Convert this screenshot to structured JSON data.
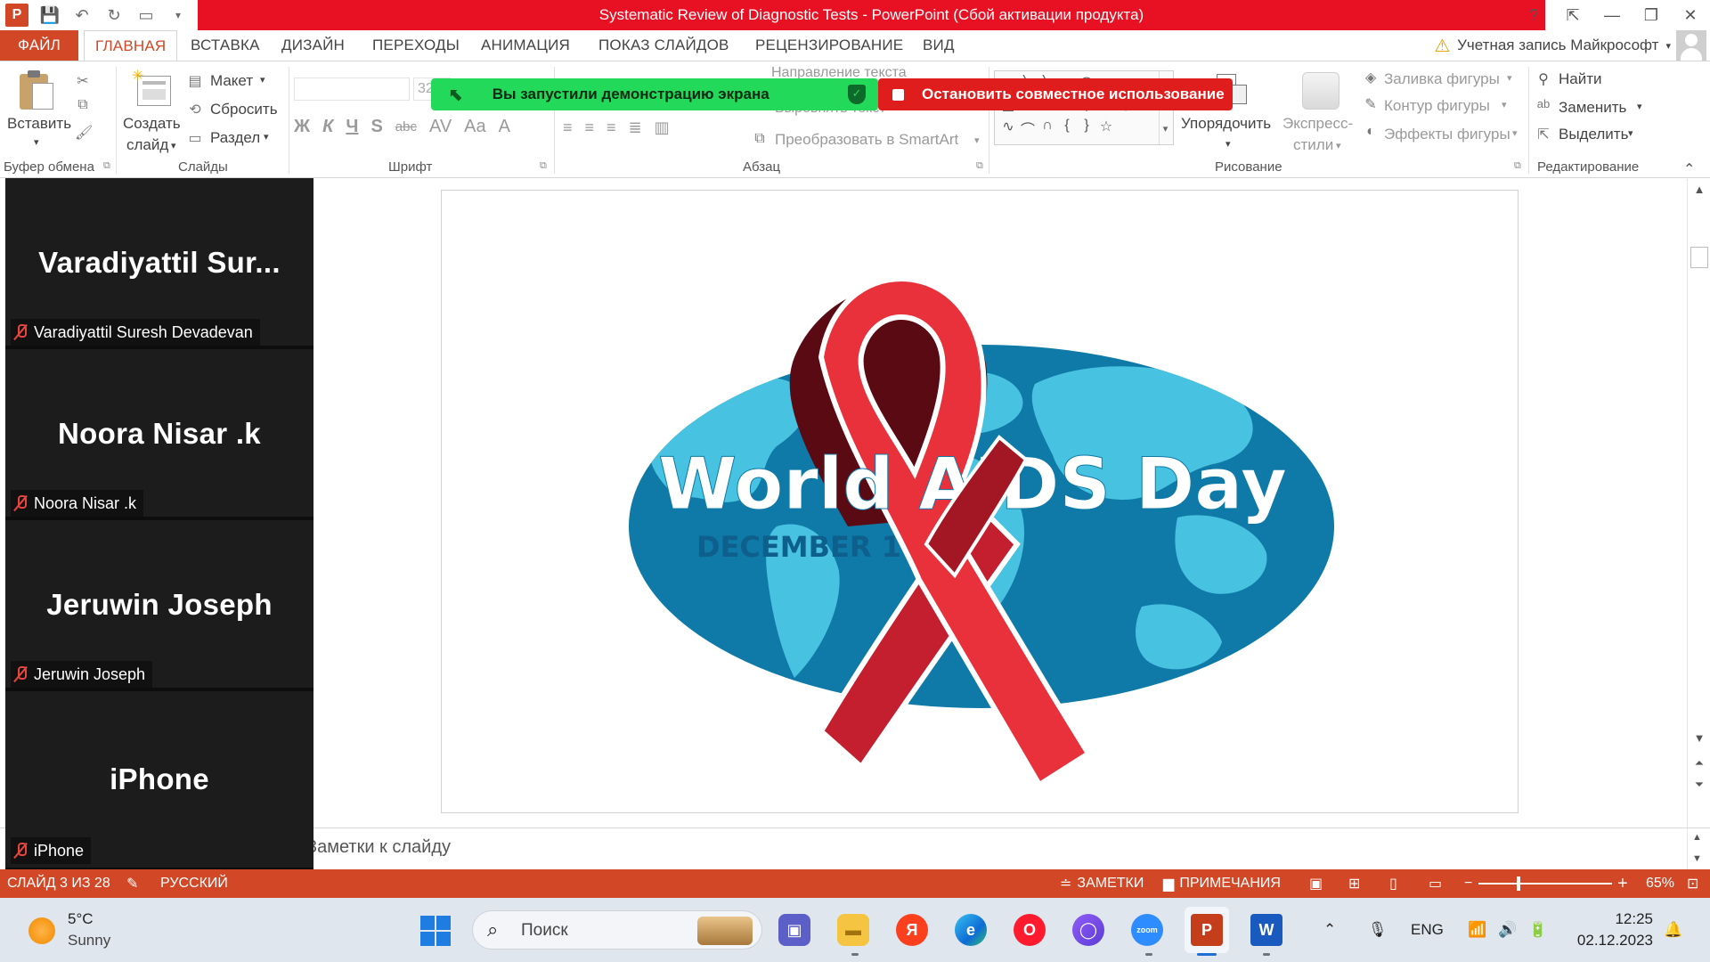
{
  "window": {
    "title": "Systematic Review of Diagnostic Tests -  PowerPoint (Сбой активации продукта)",
    "app_icon": "P",
    "help": "?",
    "account": "Учетная запись Майкрософт"
  },
  "tabs": [
    {
      "label": "ФАЙЛ"
    },
    {
      "label": "ГЛАВНАЯ"
    },
    {
      "label": "ВСТАВКА"
    },
    {
      "label": "ДИЗАЙН"
    },
    {
      "label": "ПЕРЕХОДЫ"
    },
    {
      "label": "АНИМАЦИЯ"
    },
    {
      "label": "ПОКАЗ СЛАЙДОВ"
    },
    {
      "label": "РЕЦЕНЗИРОВАНИЕ"
    },
    {
      "label": "ВИД"
    }
  ],
  "ribbon": {
    "clipboard": {
      "paste": "Вставить",
      "label": "Буфер обмена"
    },
    "slides": {
      "new_slide_line1": "Создать",
      "new_slide_line2": "слайд",
      "layout": "Макет",
      "reset": "Сбросить",
      "section": "Раздел",
      "label": "Слайды"
    },
    "font": {
      "size": "32",
      "label": "Шрифт",
      "buttons": [
        "Ж",
        "К",
        "Ч",
        "S",
        "abc",
        "AV",
        "Aa",
        "A"
      ]
    },
    "paragraph": {
      "text_direction": "Направление текста",
      "align_text": "Выровнять текст",
      "smartart": "Преобразовать в SmartArt",
      "label": "Абзац"
    },
    "drawing": {
      "arrange": "Упорядочить",
      "quick_styles_line1": "Экспресс-",
      "quick_styles_line2": "стили",
      "shape_fill": "Заливка фигуры",
      "shape_outline": "Контур фигуры",
      "shape_effects": "Эффекты фигуры",
      "label": "Рисование"
    },
    "editing": {
      "find": "Найти",
      "replace": "Заменить",
      "select": "Выделить",
      "label": "Редактирование"
    }
  },
  "share_banner": {
    "status_text": "Вы запустили демонстрацию экрана",
    "stop_text": "Остановить совместное использование",
    "green_color": "#23d959",
    "red_color": "#e01d1d"
  },
  "slide": {
    "headline": "World AIDS Day",
    "subline": "DECEMBER 1"
  },
  "notes": {
    "text": "Заметки к слайду"
  },
  "statusbar": {
    "slide_counter": "СЛАЙД 3 ИЗ 28",
    "language": "РУССКИЙ",
    "notes_btn": "ЗАМЕТКИ",
    "comments_btn": "ПРИМЕЧАНИЯ",
    "zoom": "65%",
    "zoom_fraction": 0.3
  },
  "participants": [
    {
      "tile_name": "Varadiyattil  Sur...",
      "label": "Varadiyattil Suresh Devadevan",
      "muted": true
    },
    {
      "tile_name": "Noora Nisar .k",
      "label": "Noora Nisar .k",
      "muted": true
    },
    {
      "tile_name": "Jeruwin Joseph",
      "label": "Jeruwin Joseph",
      "muted": true
    },
    {
      "tile_name": "iPhone",
      "label": "iPhone",
      "muted": true
    }
  ],
  "taskbar": {
    "weather_temp": "5°C",
    "weather_desc": "Sunny",
    "search_placeholder": "Поиск",
    "apps": [
      "chat-icon",
      "file-explorer-icon",
      "yandex-icon",
      "edge-icon",
      "opera-icon",
      "app-icon",
      "zoom-icon",
      "powerpoint-icon",
      "word-icon"
    ],
    "yandex_letter": "Я",
    "zoom_label": "zoom",
    "language": "ENG",
    "time": "12:25",
    "date": "02.12.2023"
  },
  "colors": {
    "ppt_accent": "#d24726",
    "title_bar_red": "#e81123",
    "ribbon_red": "#e8313a",
    "globe_blue": "#2b9cc4",
    "globe_dark": "#0e6f9a"
  }
}
